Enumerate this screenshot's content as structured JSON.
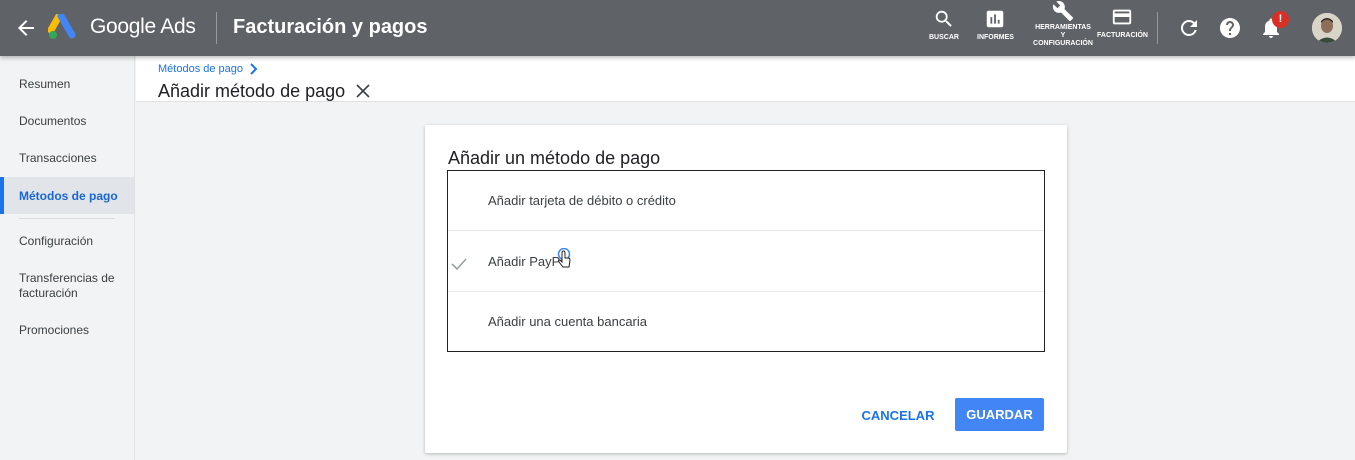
{
  "header": {
    "product_name": "Google Ads",
    "page_title": "Facturación y pagos",
    "tools": [
      {
        "label": "BUSCAR",
        "icon": "search-icon"
      },
      {
        "label": "INFORMES",
        "icon": "reports-icon"
      },
      {
        "label": "HERRAMIENTAS Y CONFIGURACIÓN",
        "icon": "wrench-icon"
      },
      {
        "label": "FACTURACIÓN",
        "icon": "credit-card-icon"
      }
    ],
    "notification_badge": "!"
  },
  "sidebar": {
    "items": [
      {
        "label": "Resumen"
      },
      {
        "label": "Documentos"
      },
      {
        "label": "Transacciones"
      },
      {
        "label": "Métodos de pago"
      },
      {
        "label": "Configuración"
      },
      {
        "label": "Transferencias de facturación"
      },
      {
        "label": "Promociones"
      }
    ],
    "active_index": 3
  },
  "subheader": {
    "breadcrumb": "Métodos de pago",
    "title": "Añadir método de pago"
  },
  "card": {
    "title": "Añadir un método de pago",
    "options": [
      {
        "label": "Añadir tarjeta de débito o crédito",
        "selected": false
      },
      {
        "label": "Añadir PayPal",
        "selected": true
      },
      {
        "label": "Añadir una cuenta bancaria",
        "selected": false
      }
    ],
    "cancel_label": "CANCELAR",
    "save_label": "GUARDAR"
  },
  "colors": {
    "header_bg": "#5f6368",
    "accent": "#1a73e8",
    "save_button": "#4285f4",
    "badge": "#d93025"
  }
}
